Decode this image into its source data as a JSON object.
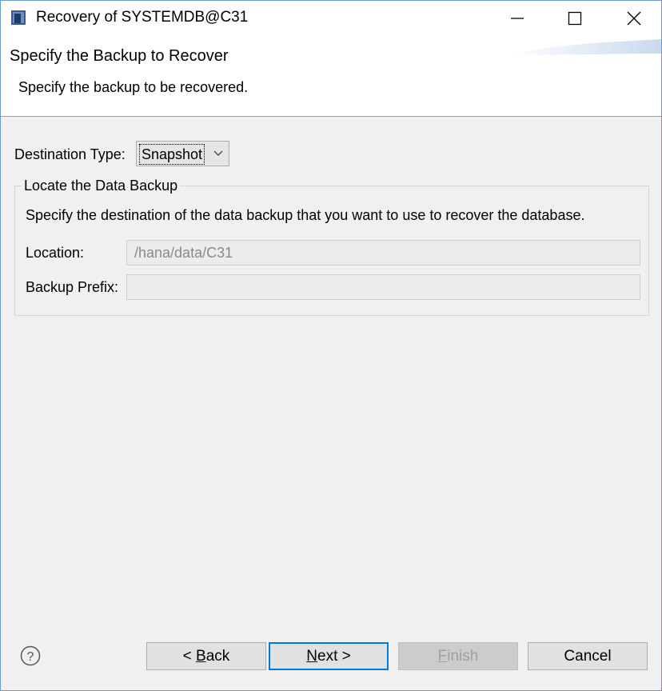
{
  "window": {
    "title": "Recovery of SYSTEMDB@C31",
    "accent_color": "#0078d7"
  },
  "header": {
    "title": "Specify the Backup to Recover",
    "description": "Specify the backup to be recovered."
  },
  "destination": {
    "label": "Destination Type:",
    "selected": "Snapshot"
  },
  "group": {
    "legend": "Locate the Data Backup",
    "description": "Specify the destination of the data backup that you want to use to recover the database.",
    "location_label": "Location:",
    "location_value": "/hana/data/C31",
    "prefix_label": "Backup Prefix:",
    "prefix_value": ""
  },
  "footer": {
    "help_icon": "question-circle-icon",
    "back": {
      "prefix": "< ",
      "mnemonic": "B",
      "rest": "ack"
    },
    "next": {
      "prefix": "",
      "mnemonic": "N",
      "rest": "ext >"
    },
    "finish": {
      "prefix": "",
      "mnemonic": "F",
      "rest": "inish",
      "enabled": false
    },
    "cancel": "Cancel"
  }
}
